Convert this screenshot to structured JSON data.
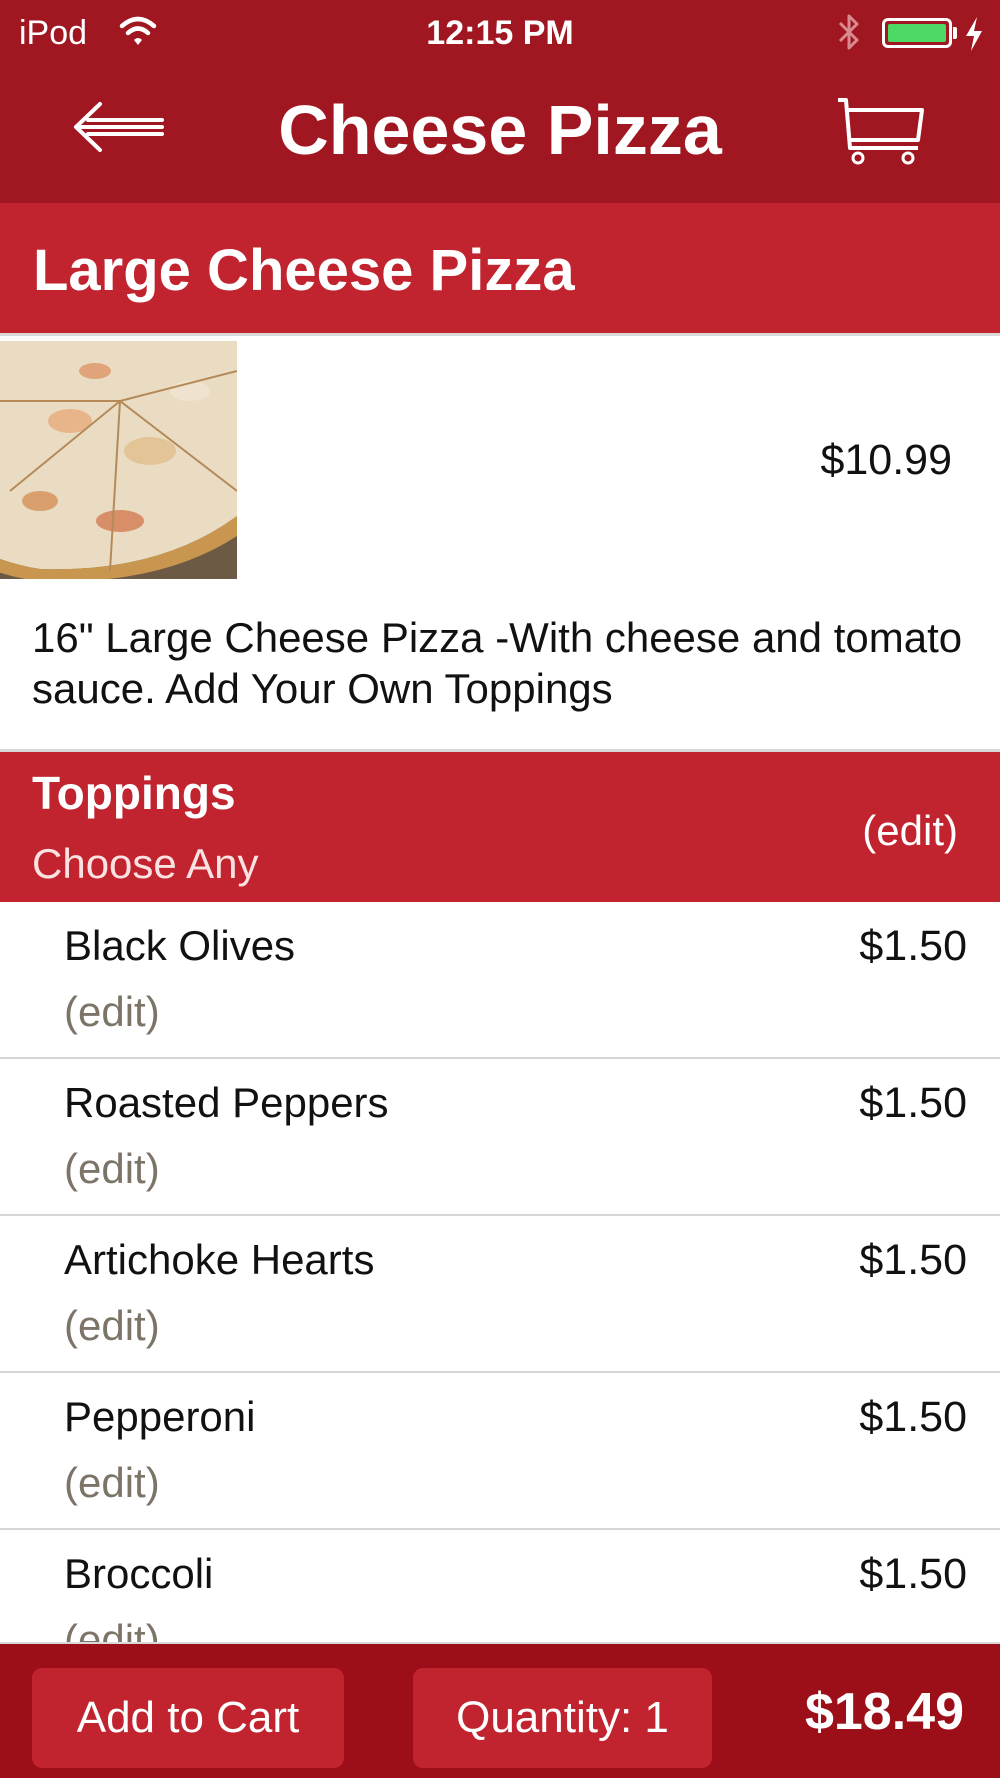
{
  "status_bar": {
    "carrier": "iPod",
    "time": "12:15 PM",
    "icons": [
      "wifi-icon",
      "bluetooth-icon",
      "battery-icon",
      "charging-bolt-icon"
    ]
  },
  "nav": {
    "title": "Cheese Pizza",
    "back_icon": "back-arrow-icon",
    "cart_icon": "cart-icon"
  },
  "product": {
    "name": "Large Cheese Pizza",
    "price": "$10.99",
    "description": "16\" Large Cheese Pizza -With cheese and tomato sauce. Add Your Own Toppings"
  },
  "toppings": {
    "title": "Toppings",
    "subtitle": "Choose Any",
    "edit_label": "(edit)",
    "items": [
      {
        "name": "Black Olives",
        "price": "$1.50",
        "edit": "(edit)"
      },
      {
        "name": "Roasted Peppers",
        "price": "$1.50",
        "edit": "(edit)"
      },
      {
        "name": "Artichoke Hearts",
        "price": "$1.50",
        "edit": "(edit)"
      },
      {
        "name": "Pepperoni",
        "price": "$1.50",
        "edit": "(edit)"
      },
      {
        "name": "Broccoli",
        "price": "$1.50",
        "edit": "(edit)"
      }
    ]
  },
  "footer": {
    "add_to_cart": "Add to Cart",
    "quantity": "Quantity: 1",
    "total": "$18.49"
  },
  "colors": {
    "nav_bar": "#a01722",
    "section_header": "#c1242f",
    "footer_bar": "#9c0e18",
    "edit_link": "#7d7468",
    "battery": "#4cd964"
  }
}
